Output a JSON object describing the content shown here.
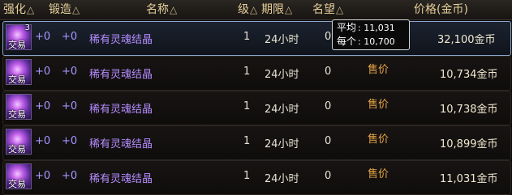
{
  "headers": {
    "enhance": "强化",
    "forge": "锻造",
    "name": "名称",
    "level": "级",
    "duration": "期限",
    "reputation": "名望",
    "price": "价格(金币)",
    "sort_glyph": "△"
  },
  "tooltip": {
    "avg_label": "平均",
    "avg_value": ": 11,031",
    "each_label": "每个",
    "each_value": ": 10,700"
  },
  "rows": [
    {
      "icon": "soul-crystal-icon",
      "badge": "交易",
      "qty": "3",
      "enhance": "+0",
      "forge": "+0",
      "name": "稀有灵魂结晶",
      "level": "1",
      "duration": "24小时",
      "reputation": "0",
      "price_label": "",
      "price": "32,100金币"
    },
    {
      "icon": "soul-crystal-icon",
      "badge": "交易",
      "qty": "",
      "enhance": "+0",
      "forge": "+0",
      "name": "稀有灵魂结晶",
      "level": "1",
      "duration": "24小时",
      "reputation": "0",
      "price_label": "售价",
      "price": "10,734金币"
    },
    {
      "icon": "soul-crystal-icon",
      "badge": "交易",
      "qty": "",
      "enhance": "+0",
      "forge": "+0",
      "name": "稀有灵魂结晶",
      "level": "1",
      "duration": "24小时",
      "reputation": "0",
      "price_label": "售价",
      "price": "10,738金币"
    },
    {
      "icon": "soul-crystal-icon",
      "badge": "交易",
      "qty": "",
      "enhance": "+0",
      "forge": "+0",
      "name": "稀有灵魂结晶",
      "level": "1",
      "duration": "24小时",
      "reputation": "0",
      "price_label": "售价",
      "price": "10,899金币"
    },
    {
      "icon": "soul-crystal-icon",
      "badge": "交易",
      "qty": "",
      "enhance": "+0",
      "forge": "+0",
      "name": "稀有灵魂结晶",
      "level": "1",
      "duration": "24小时",
      "reputation": "0",
      "price_label": "售价",
      "price": "11,031金币"
    }
  ]
}
